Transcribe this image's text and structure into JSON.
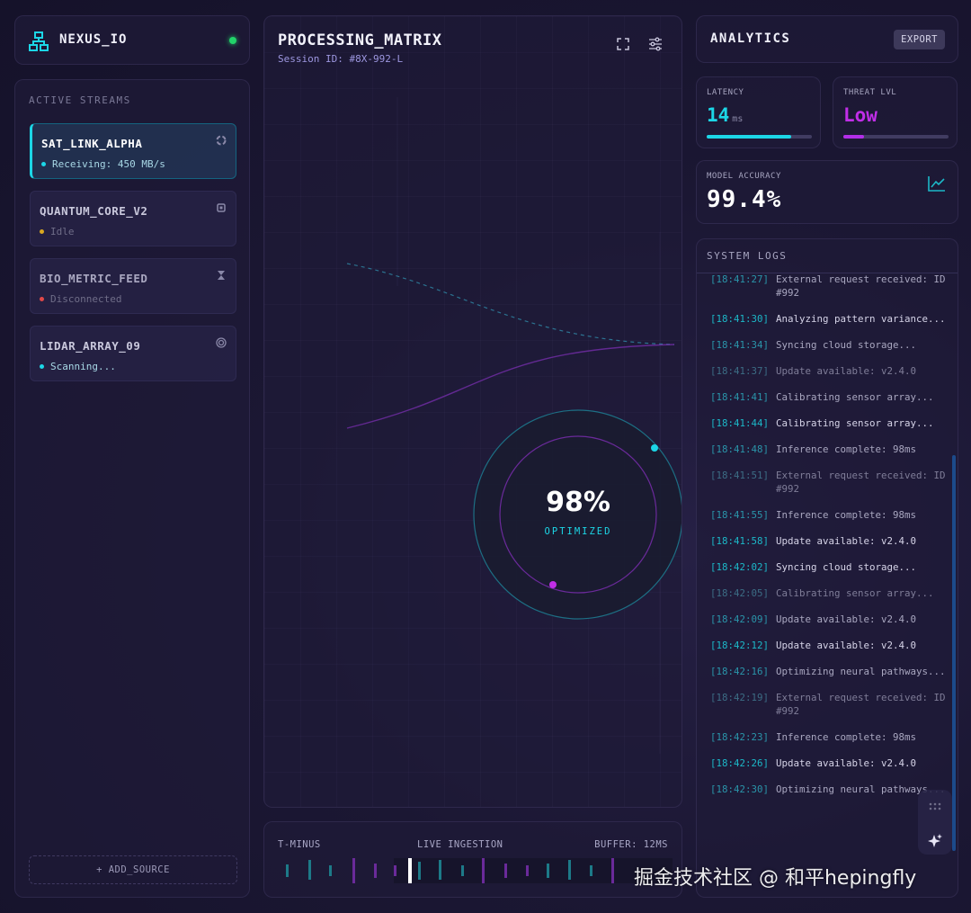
{
  "brand": {
    "name": "NEXUS_IO",
    "status_color": "#22d36a"
  },
  "streams": {
    "title": "ACTIVE STREAMS",
    "items": [
      {
        "name": "SAT_LINK_ALPHA",
        "status": "Receiving: 450 MB/s",
        "status_color": "#1cd6e6",
        "icon": "spinner-icon",
        "active": true
      },
      {
        "name": "QUANTUM_CORE_V2",
        "status": "Idle",
        "status_color": "#d9a820",
        "icon": "chip-icon",
        "active": false
      },
      {
        "name": "BIO_METRIC_FEED",
        "status": "Disconnected",
        "status_color": "#e04848",
        "icon": "hourglass-icon",
        "active": false
      },
      {
        "name": "LIDAR_ARRAY_09",
        "status": "Scanning...",
        "status_color": "#1cd6e6",
        "icon": "target-icon",
        "active": false
      }
    ],
    "add_label": "+ ADD_SOURCE"
  },
  "matrix": {
    "title": "PROCESSING_MATRIX",
    "session": "Session ID: #8X-992-L",
    "gauge_value": "98%",
    "gauge_label": "OPTIMIZED"
  },
  "timeline": {
    "left": "T-MINUS",
    "center": "LIVE INGESTION",
    "right": "BUFFER: 12MS"
  },
  "analytics": {
    "title": "ANALYTICS",
    "export_label": "EXPORT",
    "latency": {
      "label": "LATENCY",
      "value": "14",
      "unit": "ms",
      "level": 0.8,
      "color": "#1cd6e6"
    },
    "threat": {
      "label": "THREAT LVL",
      "value": "Low",
      "level": 0.2,
      "color": "#b22ee8"
    },
    "accuracy": {
      "label": "MODEL ACCURACY",
      "value": "99.4%"
    }
  },
  "logs": {
    "title": "SYSTEM LOGS",
    "entries": [
      {
        "time": "[18:41:27]",
        "msg": "External request received: ID #992",
        "tone": "mid"
      },
      {
        "time": "[18:41:30]",
        "msg": "Analyzing pattern variance...",
        "tone": "bright"
      },
      {
        "time": "[18:41:34]",
        "msg": "Syncing cloud storage...",
        "tone": "mid"
      },
      {
        "time": "[18:41:37]",
        "msg": "Update available: v2.4.0",
        "tone": "dim"
      },
      {
        "time": "[18:41:41]",
        "msg": "Calibrating sensor array...",
        "tone": "mid"
      },
      {
        "time": "[18:41:44]",
        "msg": "Calibrating sensor array...",
        "tone": "bright"
      },
      {
        "time": "[18:41:48]",
        "msg": "Inference complete: 98ms",
        "tone": "mid"
      },
      {
        "time": "[18:41:51]",
        "msg": "External request received: ID #992",
        "tone": "dim"
      },
      {
        "time": "[18:41:55]",
        "msg": "Inference complete: 98ms",
        "tone": "mid"
      },
      {
        "time": "[18:41:58]",
        "msg": "Update available: v2.4.0",
        "tone": "bright"
      },
      {
        "time": "[18:42:02]",
        "msg": "Syncing cloud storage...",
        "tone": "bright"
      },
      {
        "time": "[18:42:05]",
        "msg": "Calibrating sensor array...",
        "tone": "dim"
      },
      {
        "time": "[18:42:09]",
        "msg": "Update available: v2.4.0",
        "tone": "mid"
      },
      {
        "time": "[18:42:12]",
        "msg": "Update available: v2.4.0",
        "tone": "bright"
      },
      {
        "time": "[18:42:16]",
        "msg": "Optimizing neural pathways...",
        "tone": "mid"
      },
      {
        "time": "[18:42:19]",
        "msg": "External request received: ID #992",
        "tone": "dim"
      },
      {
        "time": "[18:42:23]",
        "msg": "Inference complete: 98ms",
        "tone": "mid"
      },
      {
        "time": "[18:42:26]",
        "msg": "Update available: v2.4.0",
        "tone": "bright"
      },
      {
        "time": "[18:42:30]",
        "msg": "Optimizing neural pathways...",
        "tone": "mid"
      }
    ]
  },
  "watermark": "掘金技术社区 @ 和平hepingfly",
  "colors": {
    "accent_cyan": "#1cd6e6",
    "accent_purple": "#b22ee8",
    "background": "#1a1630"
  }
}
